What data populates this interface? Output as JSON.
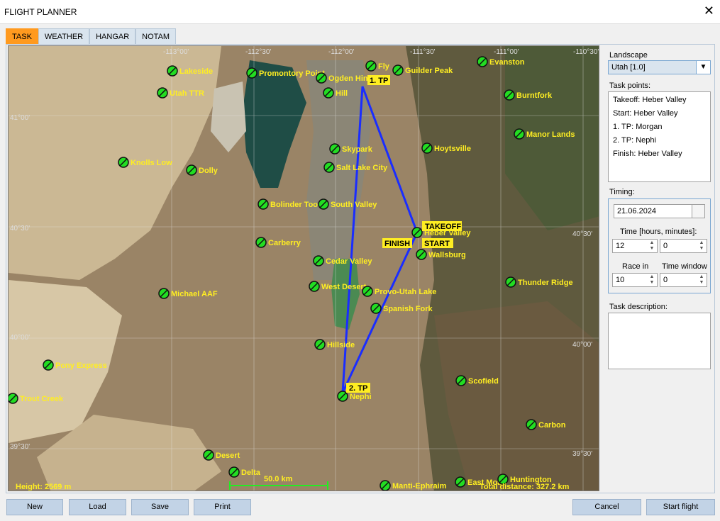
{
  "window": {
    "title": "FLIGHT PLANNER",
    "close": "✕"
  },
  "tabs": [
    "TASK",
    "WEATHER",
    "HANGAR",
    "NOTAM"
  ],
  "landscape": {
    "label": "Landscape",
    "value": "Utah [1.0]"
  },
  "task_points": {
    "label": "Task points:",
    "items": [
      "Takeoff: Heber Valley",
      "Start: Heber Valley",
      "1. TP: Morgan",
      "2. TP: Nephi",
      "Finish: Heber Valley"
    ]
  },
  "timing": {
    "label": "Timing:",
    "date": "21.06.2024",
    "time_label": "Time [hours, minutes]:",
    "hours": "12",
    "minutes": "0",
    "race_label": "Race in",
    "race_value": "10",
    "window_label": "Time window",
    "window_value": "0"
  },
  "description": {
    "label": "Task description:"
  },
  "buttons": {
    "new": "New",
    "load": "Load",
    "save": "Save",
    "print": "Print",
    "cancel": "Cancel",
    "start": "Start flight"
  },
  "map": {
    "grid_labels": [
      "-113°00'",
      "-112°30'",
      "-112°00'",
      "-111°30'",
      "-111°00'",
      "-110°30'",
      "41°00'",
      "40°30'",
      "40°00'",
      "39°30'"
    ],
    "airports": [
      "Lakeside",
      "Utah TTR",
      "Promontory Point",
      "Ogden Hinckley",
      "Hill",
      "Fly",
      "Guilder Peak",
      "Evanston",
      "Burntfork",
      "Manor Lands",
      "Hoytsville",
      "Skypark",
      "Salt Lake City",
      "Knolls Low",
      "Dolly",
      "Bolinder Tooele",
      "South Valley",
      "Carberry",
      "Cedar Valley",
      "West Desert",
      "Michael AAF",
      "Provo-Utah Lake",
      "Spanish Fork",
      "Wallsburg",
      "Heber Valley",
      "Thunder Ridge",
      "Hillside",
      "Pony Express",
      "Trout Creek",
      "Scofield",
      "Nephi",
      "Carbon",
      "Desert",
      "Delta",
      "Manti-Ephraim",
      "East Moab",
      "Huntington"
    ],
    "task_labels": {
      "tp1": "1. TP",
      "tp1_name": "Morgan",
      "tp2": "2. TP",
      "takeoff": "TAKEOFF",
      "finish": "FINISH",
      "start": "START"
    },
    "scale": "50.0 km",
    "height": "Height: 2569 m",
    "total_distance": "Total distance: 327.2 km"
  },
  "colors": {
    "accent": "#ff9a1f",
    "task_line": "#1a2dff",
    "label_bg": "#ffee22",
    "airport": "#22dd22"
  }
}
